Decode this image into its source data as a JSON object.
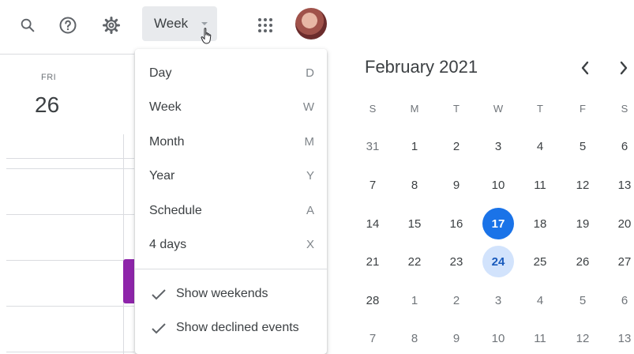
{
  "toolbar": {
    "search_icon": "search-icon",
    "help_icon": "help-icon",
    "settings_icon": "gear-icon",
    "view_button_label": "Week",
    "apps_icon": "apps-grid-icon",
    "avatar_icon": "account-avatar"
  },
  "day_column": {
    "day_name": "FRI",
    "day_number": "26",
    "event_color": "#8e24aa"
  },
  "view_menu": {
    "items": [
      {
        "label": "Day",
        "shortcut": "D"
      },
      {
        "label": "Week",
        "shortcut": "W"
      },
      {
        "label": "Month",
        "shortcut": "M"
      },
      {
        "label": "Year",
        "shortcut": "Y"
      },
      {
        "label": "Schedule",
        "shortcut": "A"
      },
      {
        "label": "4 days",
        "shortcut": "X"
      }
    ],
    "toggles": [
      {
        "label": "Show weekends",
        "checked": true
      },
      {
        "label": "Show declined events",
        "checked": true
      }
    ]
  },
  "mini_calendar": {
    "title": "February 2021",
    "prev_icon": "chevron-left-icon",
    "next_icon": "chevron-right-icon",
    "weekdays": [
      "S",
      "M",
      "T",
      "W",
      "T",
      "F",
      "S"
    ],
    "weeks": [
      [
        "31",
        "1",
        "2",
        "3",
        "4",
        "5",
        "6"
      ],
      [
        "7",
        "8",
        "9",
        "10",
        "11",
        "12",
        "13"
      ],
      [
        "14",
        "15",
        "16",
        "17",
        "18",
        "19",
        "20"
      ],
      [
        "21",
        "22",
        "23",
        "24",
        "25",
        "26",
        "27"
      ],
      [
        "28",
        "1",
        "2",
        "3",
        "4",
        "5",
        "6"
      ],
      [
        "7",
        "8",
        "9",
        "10",
        "11",
        "12",
        "13"
      ]
    ],
    "today": "17",
    "selected": "24",
    "today_color": "#1a73e8",
    "selected_color": "#d2e3fc"
  }
}
